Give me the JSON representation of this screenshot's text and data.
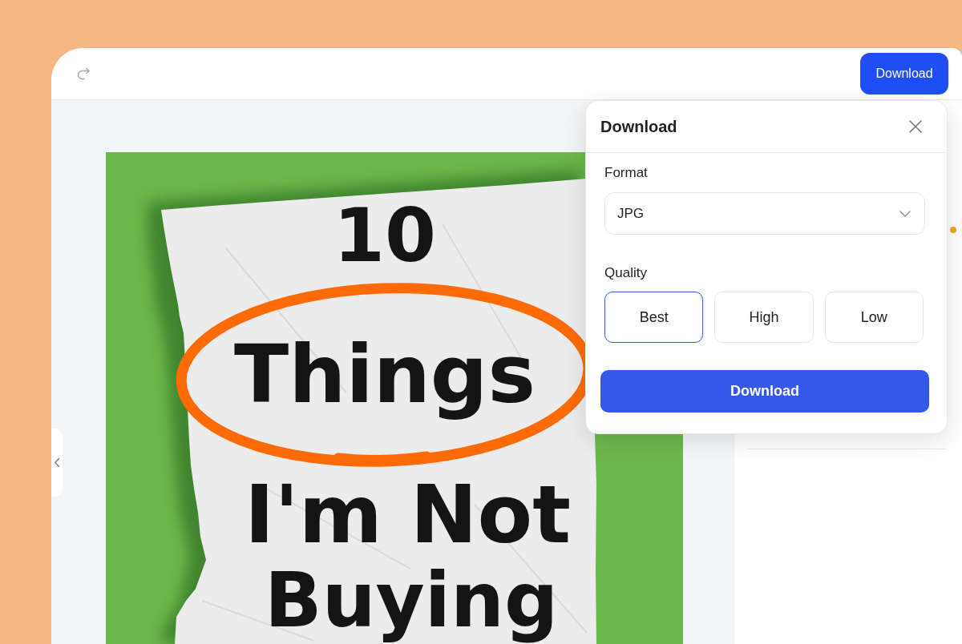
{
  "toolbar": {
    "download_button": "Download"
  },
  "canvas": {
    "poster_lines": [
      "10",
      "Things",
      "I'm Not",
      "Buying"
    ]
  },
  "download_dialog": {
    "title": "Download",
    "format": {
      "label": "Format",
      "value": "JPG"
    },
    "quality": {
      "label": "Quality",
      "options": [
        {
          "label": "Best",
          "selected": true
        },
        {
          "label": "High",
          "selected": false
        },
        {
          "label": "Low",
          "selected": false
        }
      ]
    },
    "submit_button": "Download"
  }
}
